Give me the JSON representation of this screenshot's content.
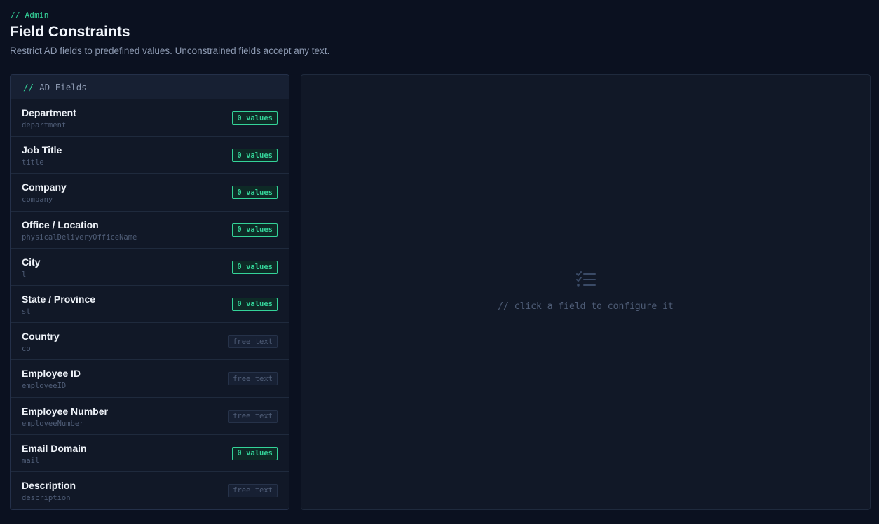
{
  "breadcrumb": "// Admin",
  "title": "Field Constraints",
  "subtitle": "Restrict AD fields to predefined values. Unconstrained fields accept any text.",
  "fields_panel": {
    "header_prefix": "//",
    "header_label": "AD Fields"
  },
  "fields": [
    {
      "label": "Department",
      "key": "department",
      "badge": "0 values",
      "constrained": true
    },
    {
      "label": "Job Title",
      "key": "title",
      "badge": "0 values",
      "constrained": true
    },
    {
      "label": "Company",
      "key": "company",
      "badge": "0 values",
      "constrained": true
    },
    {
      "label": "Office / Location",
      "key": "physicalDeliveryOfficeName",
      "badge": "0 values",
      "constrained": true
    },
    {
      "label": "City",
      "key": "l",
      "badge": "0 values",
      "constrained": true
    },
    {
      "label": "State / Province",
      "key": "st",
      "badge": "0 values",
      "constrained": true
    },
    {
      "label": "Country",
      "key": "co",
      "badge": "free text",
      "constrained": false
    },
    {
      "label": "Employee ID",
      "key": "employeeID",
      "badge": "free text",
      "constrained": false
    },
    {
      "label": "Employee Number",
      "key": "employeeNumber",
      "badge": "free text",
      "constrained": false
    },
    {
      "label": "Email Domain",
      "key": "mail",
      "badge": "0 values",
      "constrained": true
    },
    {
      "label": "Description",
      "key": "description",
      "badge": "free text",
      "constrained": false
    }
  ],
  "config_panel": {
    "empty_icon": "checklist-icon",
    "empty_message": "// click a field to configure it"
  },
  "colors": {
    "background": "#0b1120",
    "panel": "#111827",
    "accent": "#34d399",
    "muted": "#4f5d77"
  }
}
